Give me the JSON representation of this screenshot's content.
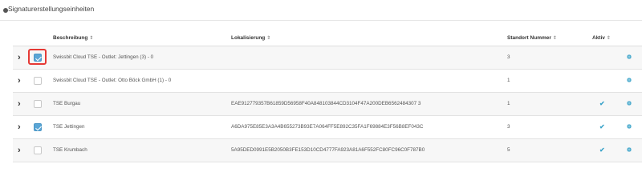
{
  "section": {
    "title": "Signaturerstellungseinheiten"
  },
  "table": {
    "columns": [
      {
        "label": "Beschreibung",
        "sort": "⇕"
      },
      {
        "label": "Lokalisierung",
        "sort": "⇕"
      },
      {
        "label": "Standort Nummer",
        "sort": "⇕"
      },
      {
        "label": "Aktiv",
        "sort": "⇕"
      }
    ],
    "rows": [
      {
        "checked": true,
        "highlighted": true,
        "description": "Swissbit Cloud TSE - Outlet: Jettingen (3) - 0",
        "localization": "",
        "location_number": "3",
        "active": false
      },
      {
        "checked": false,
        "highlighted": false,
        "description": "Swissbit Cloud TSE - Outlet: Otto Böck GmbH (1) - 0",
        "localization": "",
        "location_number": "1",
        "active": false
      },
      {
        "checked": false,
        "highlighted": false,
        "description": "TSE Burgau",
        "localization": "EAE912779357B61859D56958F40A848103844CD3104F47A200DEB6562484307 3",
        "location_number": "1",
        "active": true
      },
      {
        "checked": true,
        "highlighted": false,
        "description": "TSE Jettingen",
        "localization": "A6DA975E85E3A3A4B655273B93E7A064FF5E892C35FA1F69884E3F56B8EF043C",
        "location_number": "3",
        "active": true
      },
      {
        "checked": false,
        "highlighted": false,
        "description": "TSE Krumbach",
        "localization": "5A95DED0991E5B2050B3FE153D10CD4777FA923A81A6F552FC80FC96C0F787B0",
        "location_number": "5",
        "active": true
      }
    ]
  },
  "icons": {
    "expand": "chevron-right-icon",
    "active": "checkmark-icon",
    "settings": "gear-icon"
  },
  "colors": {
    "accent": "#3aa3c9",
    "checkbox_checked": "#5aa6d6",
    "highlight": "#e53935"
  }
}
